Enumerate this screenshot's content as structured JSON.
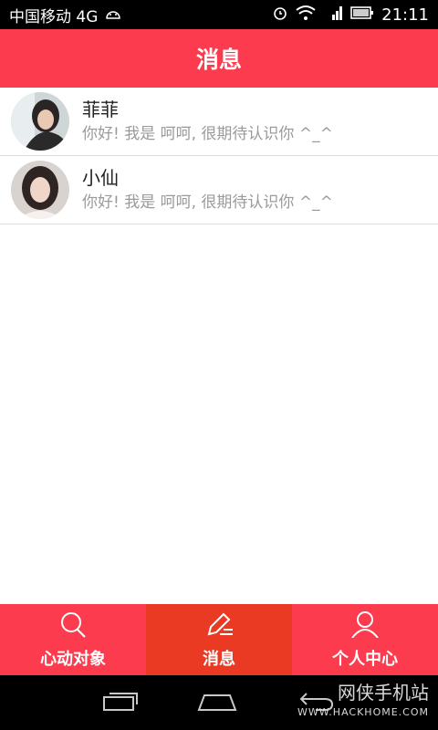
{
  "status_bar": {
    "carrier": "中国移动 4G",
    "time": "21:11",
    "icons": [
      "android-icon",
      "alarm-icon",
      "wifi-icon",
      "signal-4g-icon",
      "battery-icon"
    ]
  },
  "header": {
    "title": "消息"
  },
  "messages": [
    {
      "name": "菲菲",
      "preview": "你好! 我是 呵呵, 很期待认识你 ^_^"
    },
    {
      "name": "小仙",
      "preview": "你好! 我是 呵呵, 很期待认识你 ^_^"
    }
  ],
  "tabs": [
    {
      "label": "心动对象",
      "icon": "search-icon",
      "active": false
    },
    {
      "label": "消息",
      "icon": "pen-icon",
      "active": true
    },
    {
      "label": "个人中心",
      "icon": "person-icon",
      "active": false
    }
  ],
  "watermark": {
    "title": "网侠手机站",
    "url": "WWW.HACKHOME.COM"
  },
  "colors": {
    "accent": "#fd3b4f",
    "active_tab": "#ea3a24"
  }
}
